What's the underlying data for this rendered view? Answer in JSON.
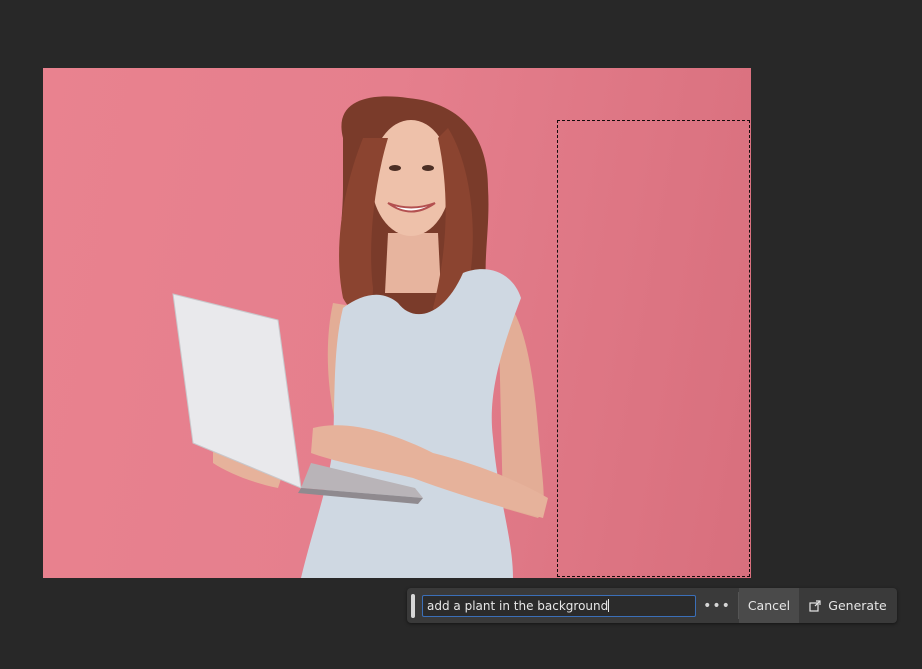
{
  "canvas": {
    "image_description_icon": "photo-woman-laptop",
    "background_color": "#e5808d"
  },
  "taskbar": {
    "prompt_value": "add a plant in the background",
    "more_icon": "ellipsis-icon",
    "more_label": "•••",
    "cancel_label": "Cancel",
    "generate_label": "Generate",
    "generate_icon": "generative-fill-icon",
    "accent_color": "#3b6fb8"
  }
}
